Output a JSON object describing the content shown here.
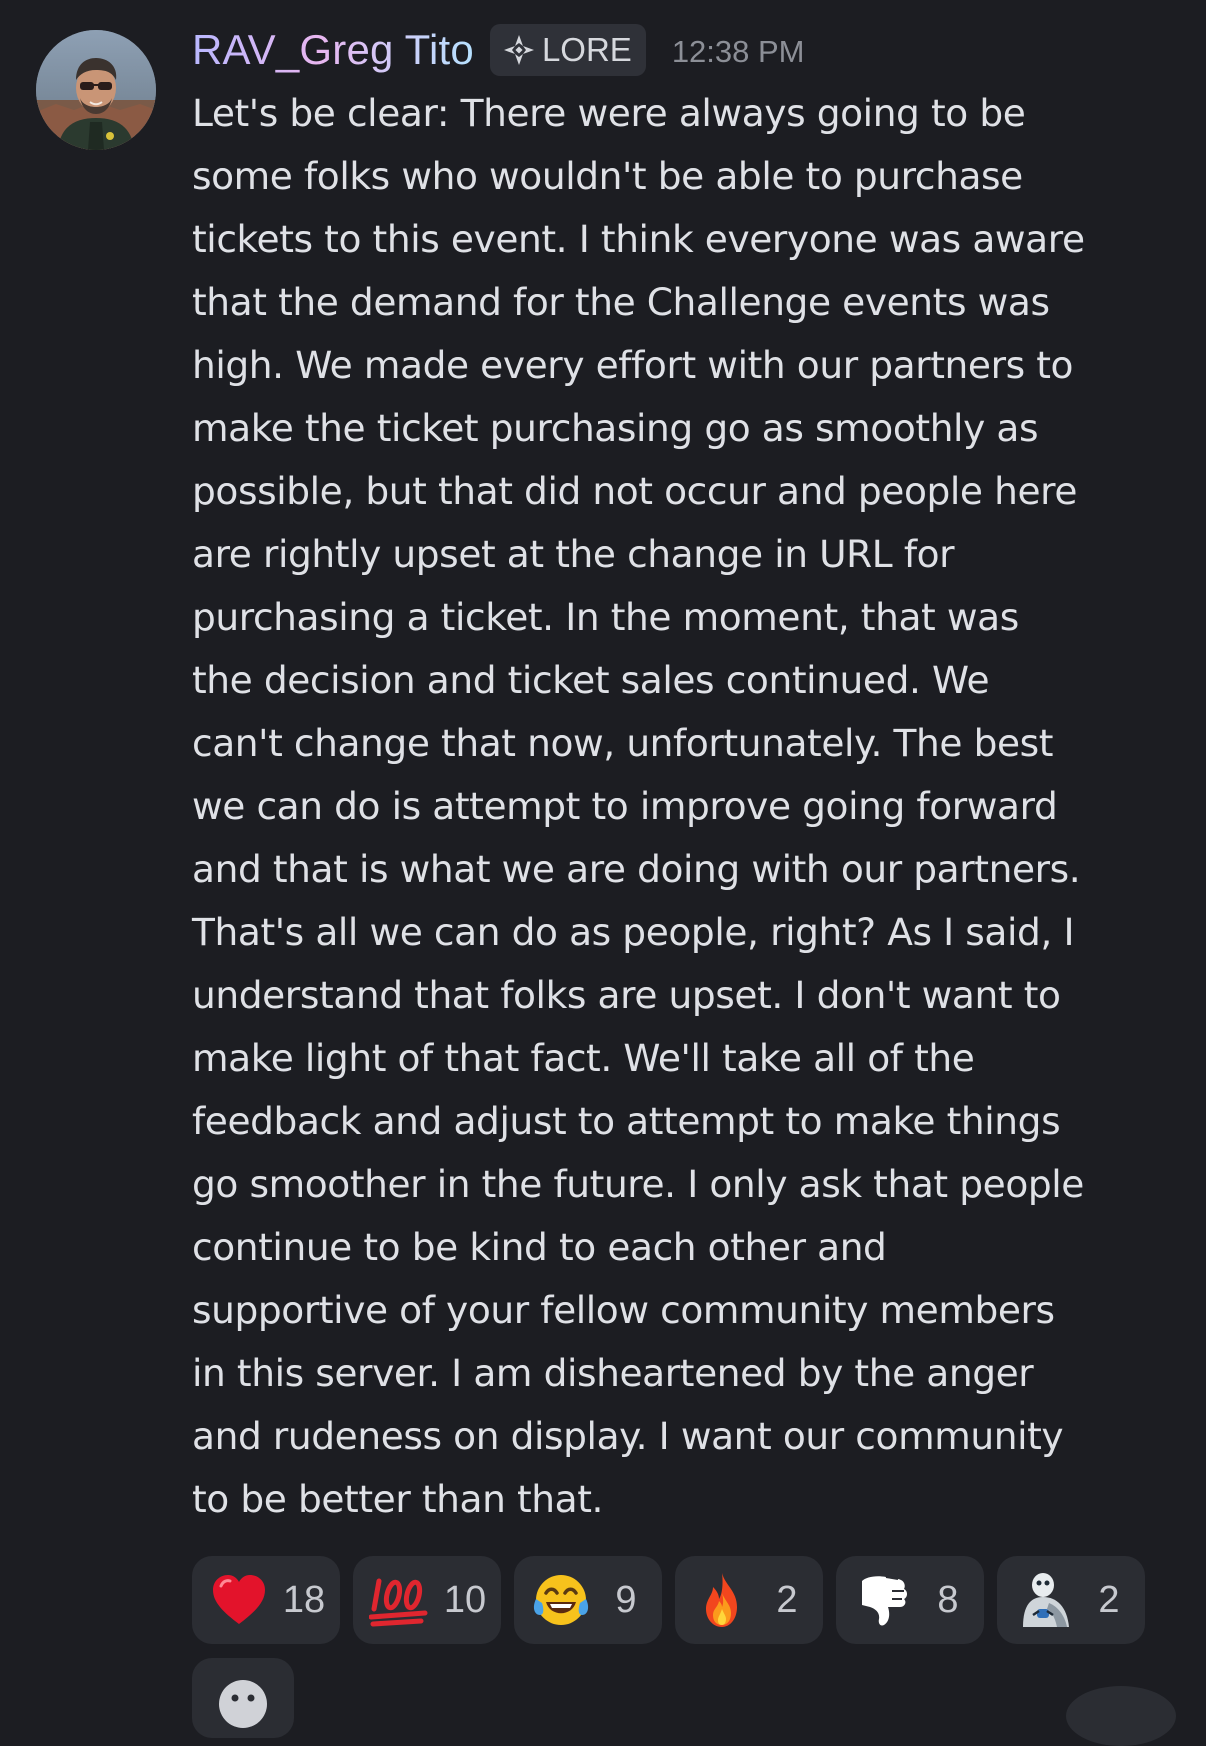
{
  "message": {
    "author": "RAV_Greg Tito",
    "role_tag": {
      "icon": "crosshair-diamond-icon",
      "label": "LORE"
    },
    "timestamp": "12:38 PM",
    "lines": [
      "Let's be clear: There were always going to be",
      "some folks who wouldn't be able to purchase",
      "tickets to this event. I think everyone was aware",
      "that the demand for the Challenge events was",
      "high. We made every effort with our partners to",
      "make the ticket purchasing go as smoothly as",
      "possible, but that did not occur and people here",
      "are rightly upset at the change in URL for",
      "purchasing a ticket. In the moment, that was",
      "the decision and ticket sales continued. We",
      "can't change that now, unfortunately. The best",
      "we can do is attempt to improve going forward",
      "and that is what we are doing with our partners.",
      "That's all we can do as people, right? As I said, I",
      "understand that folks are upset. I don't want to",
      "make light of that fact. We'll take all of the",
      "feedback and adjust to attempt to make things",
      "go smoother in the future. I only ask that people",
      "continue to be kind to each other and",
      "supportive of your fellow community members",
      "in this server. I am disheartened by the anger",
      "and rudeness on display. I want our community",
      "to be better than that."
    ]
  },
  "reactions": [
    {
      "emoji": "red-heart-icon",
      "count": "18"
    },
    {
      "emoji": "hundred-points-icon",
      "count": "10"
    },
    {
      "emoji": "tears-of-joy-icon",
      "count": "9"
    },
    {
      "emoji": "fire-icon",
      "count": "2"
    },
    {
      "emoji": "thumbs-down-icon",
      "count": "8"
    },
    {
      "emoji": "custom-figure-icon",
      "count": "2"
    }
  ],
  "add_reaction": {
    "icon": "smiley-icon"
  },
  "colors": {
    "background": "#1c1d22",
    "reaction_pill": "#2b2d33",
    "tag_background": "#2f3138",
    "message_text": "#dfe1e6",
    "timestamp_text": "#8c8f97"
  }
}
